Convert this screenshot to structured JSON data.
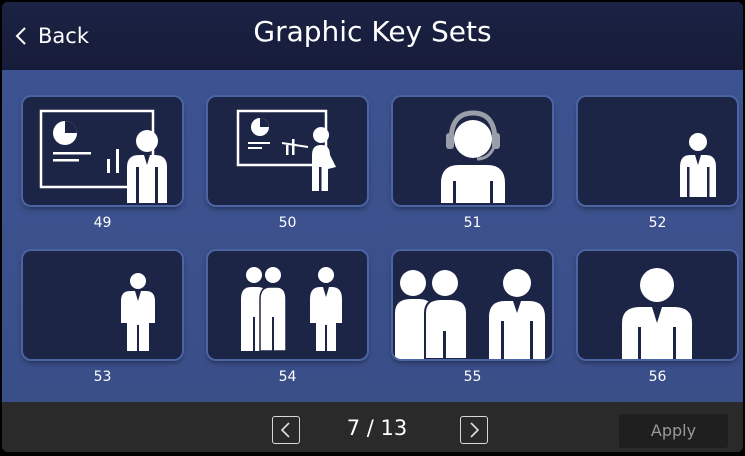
{
  "header": {
    "back_label": "Back",
    "title": "Graphic Key Sets"
  },
  "tiles": [
    {
      "number": "49",
      "icon": "presentation-chart-person-icon"
    },
    {
      "number": "50",
      "icon": "presenter-pointing-board-icon"
    },
    {
      "number": "51",
      "icon": "headset-operator-icon"
    },
    {
      "number": "52",
      "icon": "person-right-icon"
    },
    {
      "number": "53",
      "icon": "person-center-icon"
    },
    {
      "number": "54",
      "icon": "three-people-icon"
    },
    {
      "number": "55",
      "icon": "three-people-large-icon"
    },
    {
      "number": "56",
      "icon": "single-person-large-icon"
    }
  ],
  "footer": {
    "page_indicator": "7 / 13",
    "apply_label": "Apply"
  },
  "colors": {
    "header_bg": "#1b2244",
    "grid_bg": "#3d5391",
    "tile_bg": "#1d2546",
    "footer_bg": "#2a2a2a"
  }
}
